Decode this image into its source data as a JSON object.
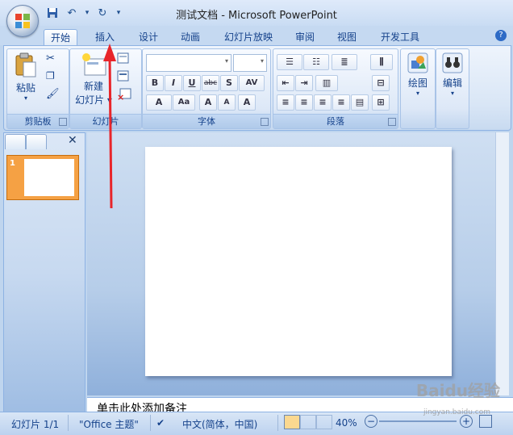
{
  "window": {
    "title": "测试文档 - Microsoft PowerPoint"
  },
  "qat": {
    "save": "💾",
    "undo": "↶",
    "redo": "↻",
    "dropdown": "▾"
  },
  "tabs": [
    {
      "label": "开始",
      "active": true
    },
    {
      "label": "插入",
      "active": false
    },
    {
      "label": "设计",
      "active": false
    },
    {
      "label": "动画",
      "active": false
    },
    {
      "label": "幻灯片放映",
      "active": false
    },
    {
      "label": "审阅",
      "active": false
    },
    {
      "label": "视图",
      "active": false
    },
    {
      "label": "开发工具",
      "active": false
    }
  ],
  "ribbon": {
    "clipboard": {
      "label": "剪贴板",
      "paste": "粘贴"
    },
    "slides": {
      "label": "幻灯片",
      "new_slide_line1": "新建",
      "new_slide_line2": "幻灯片 ▾"
    },
    "font": {
      "label": "字体",
      "bold": "B",
      "italic": "I",
      "underline": "U",
      "strike": "abc",
      "shadow": "S",
      "spacing": "AV",
      "grow": "A",
      "shrink": "A",
      "case": "Aa",
      "color": "A",
      "clear": "A"
    },
    "paragraph": {
      "label": "段落"
    },
    "drawing": {
      "label": "绘图"
    },
    "editing": {
      "label": "编辑"
    }
  },
  "notes": {
    "placeholder": "单击此处添加备注"
  },
  "thumbnails": [
    {
      "number": "1"
    }
  ],
  "status": {
    "slide_info": "幻灯片 1/1",
    "theme": "\"Office 主题\"",
    "language": "中文(简体，中国)",
    "zoom": "40%"
  },
  "watermark": {
    "text": "Baidu经验",
    "sub": "jingyan.baidu.com"
  },
  "colors": {
    "accent": "#15428b",
    "arrow": "#e8252a",
    "thumb_selected": "#f5a144"
  }
}
